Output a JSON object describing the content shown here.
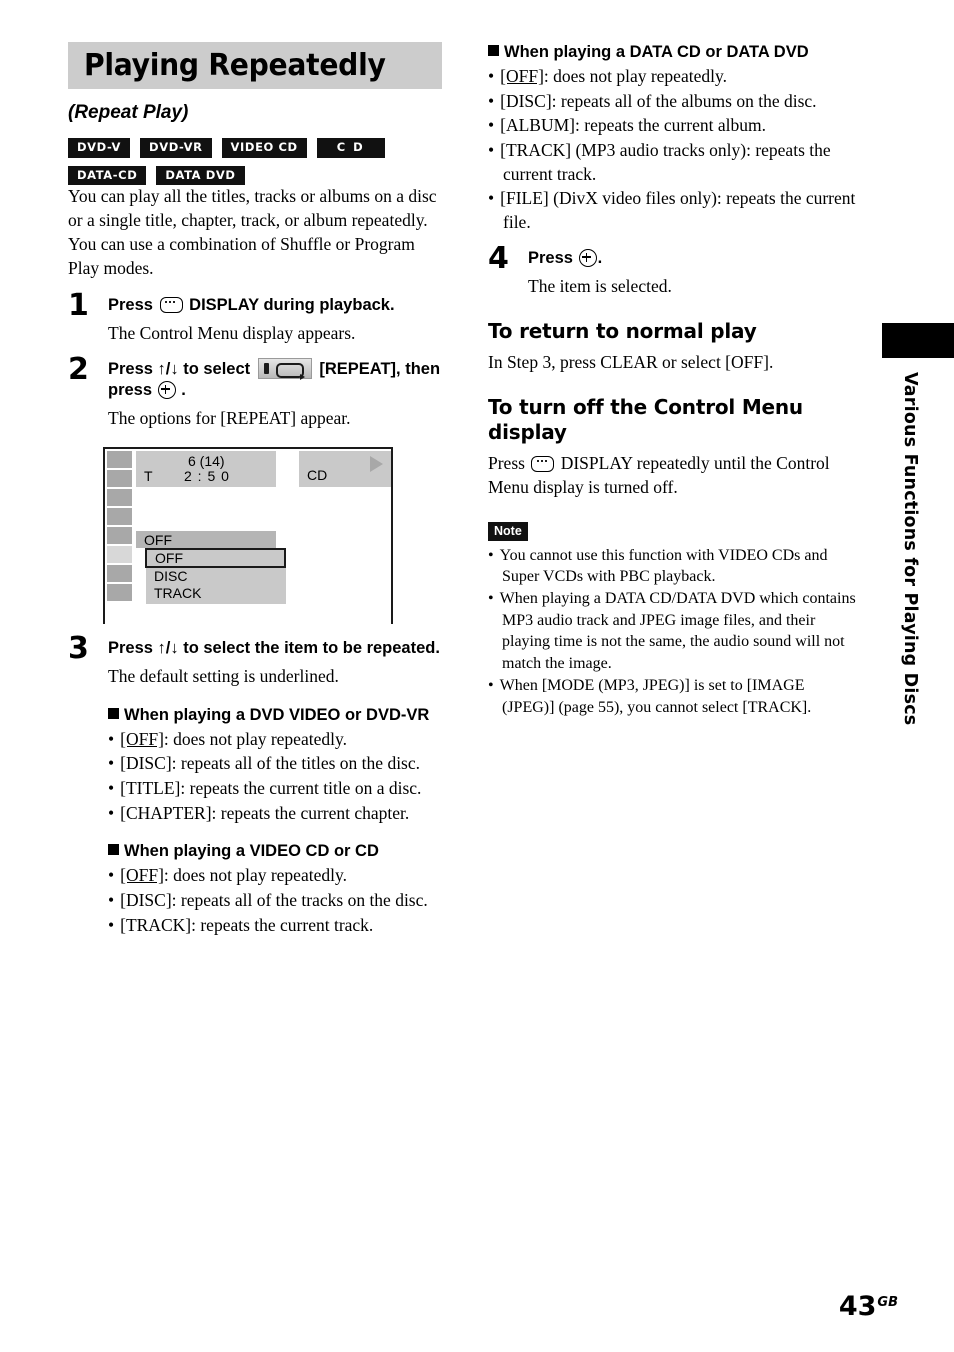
{
  "section": {
    "title": "Playing Repeatedly",
    "subtitle": "(Repeat Play)"
  },
  "disc_badges": [
    {
      "label": "DVD-V"
    },
    {
      "label": "DVD-VR"
    },
    {
      "label": "VIDEO CD"
    },
    {
      "label": "C D"
    },
    {
      "label": "DATA-CD"
    },
    {
      "label": "DATA DVD"
    }
  ],
  "intro": {
    "paragraph1": "You can play all the titles, tracks or albums on a disc or a single title, chapter, track, or album repeatedly.",
    "paragraph2": "You can use a combination of Shuffle or Program Play modes."
  },
  "steps": {
    "step1": {
      "number": "1",
      "head_before_icon": "Press",
      "icon": "display-icon",
      "head_after_icon": "DISPLAY during playback.",
      "body": "The Control Menu display appears."
    },
    "step2": {
      "number": "2",
      "head_part1": "Press ↑/↓ to select",
      "icon1": "repeat-menu-icon",
      "head_part2": "[REPEAT], then press",
      "icon2": "enter-icon",
      "head_part3": ".",
      "body": "The options for [REPEAT] appear."
    },
    "step3": {
      "number": "3",
      "head": "Press ↑/↓ to select the item to be repeated.",
      "body": "The default setting is underlined."
    },
    "step4": {
      "number": "4",
      "head_before_icon": "Press",
      "icon": "enter-icon",
      "head_after_icon": ".",
      "body": "The item is selected."
    }
  },
  "control_menu_figure": {
    "track_number": "6 (14)",
    "time_label": "T",
    "time_value": "2 : 5 0",
    "disc_label": "CD",
    "play_icon": "play-triangle-icon",
    "current_setting": "OFF",
    "options": [
      {
        "label": "OFF",
        "selected": true
      },
      {
        "label": "DISC",
        "selected": false
      },
      {
        "label": "TRACK",
        "selected": false
      }
    ],
    "icon_column_cells": 8,
    "icon_column_active_index": 5
  },
  "dvd_section": {
    "heading": "When playing a DVD VIDEO or DVD-VR",
    "items": [
      {
        "key": "[OFF]",
        "underlined": true,
        "text": ": does not play repeatedly."
      },
      {
        "key": "[DISC]",
        "underlined": false,
        "text": ": repeats all of the titles on the disc."
      },
      {
        "key": "[TITLE]",
        "underlined": false,
        "text": ": repeats the current title on a disc."
      },
      {
        "key": "[CHAPTER]",
        "underlined": false,
        "text": ": repeats the current chapter."
      }
    ]
  },
  "videocd_section": {
    "heading": "When playing a VIDEO CD or CD",
    "items": [
      {
        "key": "[OFF]",
        "underlined": true,
        "text": ": does not play repeatedly."
      },
      {
        "key": "[DISC]",
        "underlined": false,
        "text": ": repeats all of the tracks on the disc."
      },
      {
        "key": "[TRACK]",
        "underlined": false,
        "text": ": repeats the current track."
      }
    ]
  },
  "datacd_section": {
    "heading": "When playing a DATA CD or DATA DVD",
    "items": [
      {
        "key": "[OFF]",
        "underlined": true,
        "text": ": does not play repeatedly."
      },
      {
        "key": "[DISC]",
        "underlined": false,
        "text": ": repeats all of the albums on the disc."
      },
      {
        "key": "[ALBUM]",
        "underlined": false,
        "text": ": repeats the current album."
      },
      {
        "key": "[TRACK]",
        "underlined": false,
        "text": " (MP3 audio tracks only): repeats the current track."
      },
      {
        "key": "[FILE]",
        "underlined": false,
        "text": " (DivX video files only): repeats the current file."
      }
    ]
  },
  "return_normal": {
    "heading": "To return to normal play",
    "body": "In Step 3, press CLEAR or select [OFF]."
  },
  "turn_off_menu": {
    "heading": "To turn off the Control Menu display",
    "body_before_icon": "Press",
    "icon": "display-icon",
    "body_after_icon": "DISPLAY repeatedly until the Control Menu display is turned off."
  },
  "note": {
    "badge": "Note",
    "items": [
      "You cannot use this function with VIDEO CDs and Super VCDs with PBC playback.",
      "When playing a DATA CD/DATA DVD which contains MP3 audio track and JPEG image files, and their playing time is not the same, the audio sound will not match the image.",
      "When [MODE (MP3, JPEG)] is set to [IMAGE (JPEG)] (page 55), you cannot select [TRACK]."
    ]
  },
  "side_tab": {
    "text": "Various Functions for Playing Discs"
  },
  "page_number": {
    "number": "43",
    "suffix": "GB"
  },
  "colors": {
    "banner_gray": "#cccccc",
    "badge_black": "#111111",
    "figure_panel": "#c9c9c9",
    "figure_iconcell": "#a8a8a8"
  }
}
